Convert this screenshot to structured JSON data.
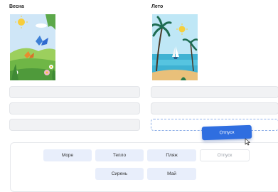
{
  "columns": {
    "spring": {
      "title": "Весна"
    },
    "summer": {
      "title": "Лето"
    }
  },
  "bank": {
    "chips": [
      {
        "label": "Море"
      },
      {
        "label": "Тепло"
      },
      {
        "label": "Пляж"
      },
      {
        "label": "Отпуск"
      },
      {
        "label": "Сирень"
      },
      {
        "label": "Май"
      }
    ]
  },
  "dragging": {
    "label": "Отпуск"
  },
  "colors": {
    "accent": "#2f6ee0",
    "chip_bg": "#e8eefb",
    "slot_bg": "#f1f2f4"
  }
}
